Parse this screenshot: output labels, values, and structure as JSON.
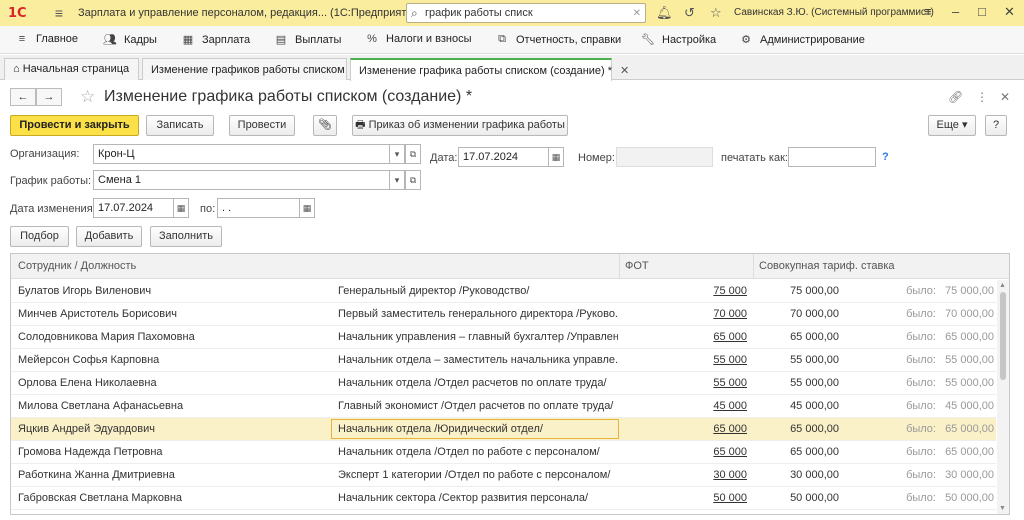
{
  "titlebar": {
    "logo": "1С",
    "app_title": "Зарплата и управление персоналом, редакция... (1С:Предприятие)",
    "search_value": "график работы списк",
    "user": "Савинская З.Ю. (Системный программист)"
  },
  "sections": [
    "Главное",
    "Кадры",
    "Зарплата",
    "Выплаты",
    "Налоги и взносы",
    "Отчетность, справки",
    "Настройка",
    "Администрирование"
  ],
  "tabs": [
    "Начальная страница",
    "Изменение графиков работы списком",
    "Изменение графика работы списком (создание) *"
  ],
  "form": {
    "title": "Изменение графика работы списком (создание) *",
    "btn_post_close": "Провести и закрыть",
    "btn_save": "Записать",
    "btn_post": "Провести",
    "btn_order": "Приказ об изменении графика работы",
    "btn_more": "Еще",
    "btn_help": "?",
    "org_label": "Организация:",
    "org_value": "Крон-Ц",
    "date_label": "Дата:",
    "date_value": "17.07.2024",
    "number_label": "Номер:",
    "number_value": "",
    "print_as_label": "печатать как:",
    "print_as_value": "",
    "print_help": "?",
    "schedule_label": "График работы:",
    "schedule_value": "Смена 1",
    "change_date_label": "Дата изменения:",
    "change_date_value": "17.07.2024",
    "to_label": "по:",
    "to_value": ". .",
    "btn_pick": "Подбор",
    "btn_add": "Добавить",
    "btn_fill": "Заполнить"
  },
  "table": {
    "headers": {
      "employee": "Сотрудник / Должность",
      "fot": "ФОТ",
      "rate": "Совокупная тариф. ставка"
    },
    "was_label": "было:",
    "rows": [
      {
        "name": "Булатов Игорь Виленович",
        "position": "Генеральный директор /Руководство/",
        "fot": "75 000",
        "rate": "75 000,00",
        "was": "75 000,00"
      },
      {
        "name": "Минчев Аристотель Борисович",
        "position": "Первый заместитель генерального директора /Руково...",
        "fot": "70 000",
        "rate": "70 000,00",
        "was": "70 000,00"
      },
      {
        "name": "Солодовникова Мария Пахомовна",
        "position": "Начальник управления – главный бухгалтер /Управлен...",
        "fot": "65 000",
        "rate": "65 000,00",
        "was": "65 000,00"
      },
      {
        "name": "Мейерсон Софья Карповна",
        "position": "Начальник отдела – заместитель начальника управле...",
        "fot": "55 000",
        "rate": "55 000,00",
        "was": "55 000,00"
      },
      {
        "name": "Орлова Елена Николаевна",
        "position": "Начальник отдела /Отдел расчетов по оплате труда/",
        "fot": "55 000",
        "rate": "55 000,00",
        "was": "55 000,00"
      },
      {
        "name": "Милова Светлана Афанасьевна",
        "position": "Главный экономист /Отдел расчетов по оплате труда/",
        "fot": "45 000",
        "rate": "45 000,00",
        "was": "45 000,00"
      },
      {
        "name": "Яцкив Андрей Эдуардович",
        "position": "Начальник отдела /Юридический отдел/",
        "fot": "65 000",
        "rate": "65 000,00",
        "was": "65 000,00"
      },
      {
        "name": "Громова Надежда Петровна",
        "position": "Начальник отдела /Отдел по работе с персоналом/",
        "fot": "65 000",
        "rate": "65 000,00",
        "was": "65 000,00"
      },
      {
        "name": "Работкина Жанна Дмитриевна",
        "position": "Эксперт 1 категории /Отдел по работе с персоналом/",
        "fot": "30 000",
        "rate": "30 000,00",
        "was": "30 000,00"
      },
      {
        "name": "Габровская Светлана Марковна",
        "position": "Начальник сектора /Сектор развития персонала/",
        "fot": "50 000",
        "rate": "50 000,00",
        "was": "50 000,00"
      }
    ],
    "selected_row": 6
  },
  "colors": {
    "titlebar": "#fbed9e",
    "primary_button": "#fbe147",
    "selected_row": "#fbf1c9",
    "active_tab_line": "#4caf50"
  }
}
